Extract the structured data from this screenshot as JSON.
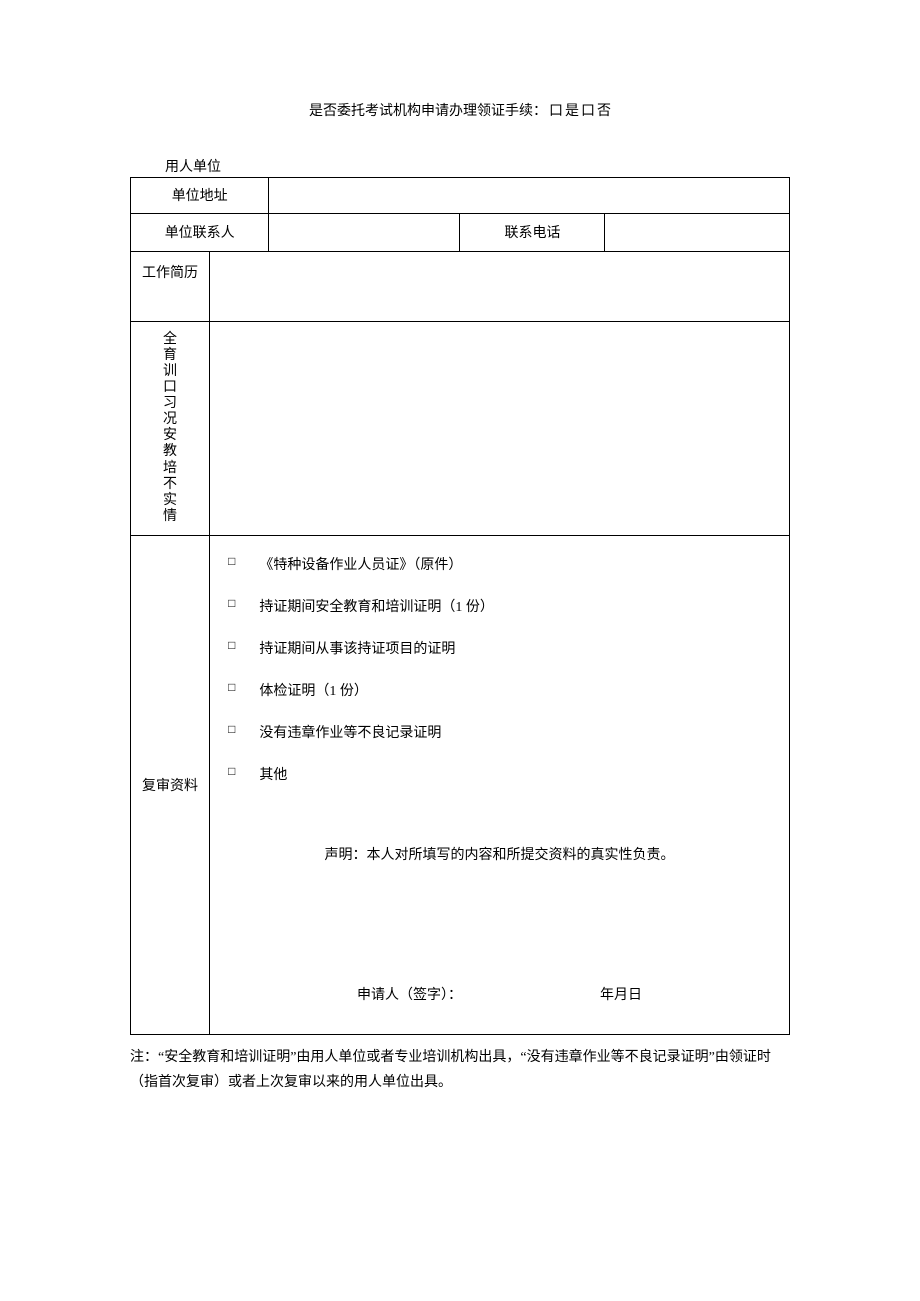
{
  "title": {
    "prefix": "是否委托考试机构申请办理领证手续：",
    "yes_box": "口",
    "yes_label": "是",
    "no_box": "口",
    "no_label": "否"
  },
  "hanging": {
    "employer": "用人单位"
  },
  "labels": {
    "address": "单位地址",
    "contact": "单位联系人",
    "phone": "联系电话",
    "work_history": "工作简历",
    "safety_training": "全\n育\n训\n口\n习\n况\n安\n教\n培\n不\n实\n情",
    "review_materials": "复审资料"
  },
  "checklist": {
    "item1": "《特种设备作业人员证》（原件）",
    "item2": "持证期间安全教育和培训证明（1 份）",
    "item3": "持证期间从事该持证项目的证明",
    "item4": "体检证明（1 份）",
    "item5": "没有违章作业等不良记录证明",
    "item6": "其他",
    "box": "□"
  },
  "statement": "声明：本人对所填写的内容和所提交资料的真实性负责。",
  "signature": {
    "label": "申请人（签字）：",
    "date": "年月日"
  },
  "note": "注：“安全教育和培训证明”由用人单位或者专业培训机构出具，“没有违章作业等不良记录证明”由领证时（指首次复审）或者上次复审以来的用人单位出具。"
}
